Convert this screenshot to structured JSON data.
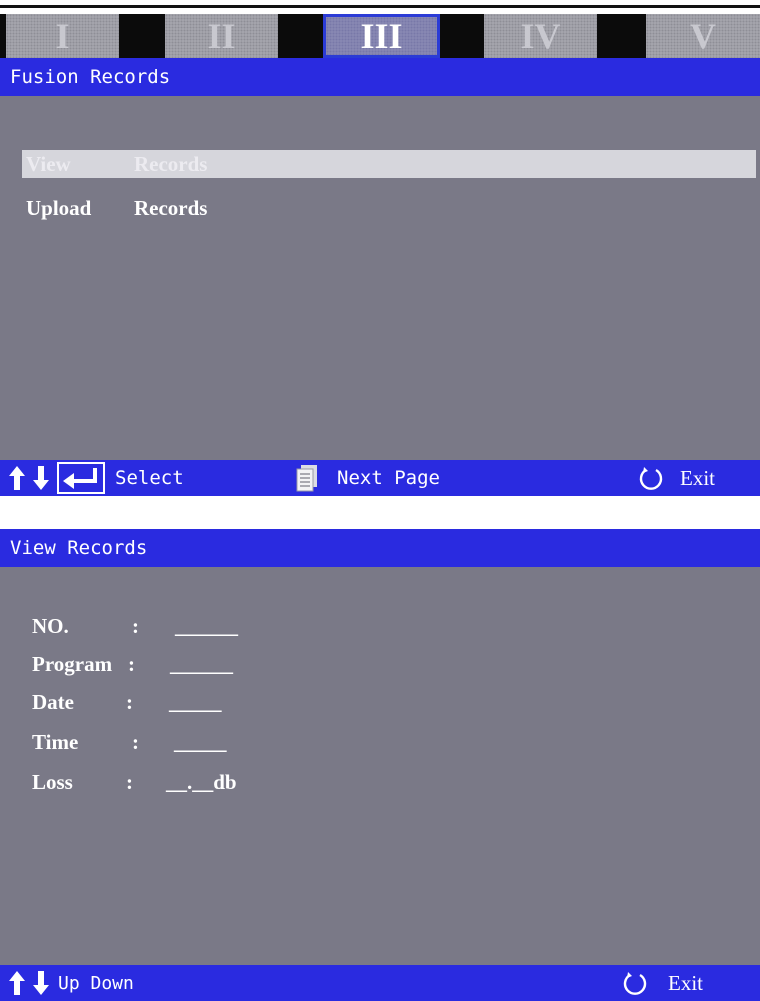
{
  "screen1": {
    "tabs": [
      "I",
      "II",
      "III",
      "IV",
      "V"
    ],
    "active_tab": "III",
    "title": "Fusion Records",
    "menu": [
      {
        "word1": "View",
        "word2": "Records",
        "selected": true
      },
      {
        "word1": "Upload",
        "word2": "Records",
        "selected": false
      }
    ],
    "status": {
      "select_label": "Select",
      "next_page_label": "Next Page",
      "exit_label": "Exit"
    }
  },
  "screen2": {
    "title": "View Records",
    "fields": [
      {
        "label": "NO.",
        "colon": ":",
        "value": "______"
      },
      {
        "label": "Program",
        "colon": ":",
        "value": "______"
      },
      {
        "label": "Date",
        "colon": ":",
        "value": "_____"
      },
      {
        "label": "Time",
        "colon": ":",
        "value": "_____"
      },
      {
        "label": "Loss",
        "colon": ":",
        "value": "__.__db"
      }
    ],
    "status": {
      "updown_label": "Up Down",
      "exit_label": "Exit"
    }
  },
  "colors": {
    "bar_blue": "#2a2be0",
    "panel_gray": "#7a7987",
    "selection": "#d6d6dc"
  },
  "icons": [
    "up-arrow-icon",
    "down-arrow-icon",
    "enter-icon",
    "page-icon",
    "exit-circle-icon"
  ]
}
